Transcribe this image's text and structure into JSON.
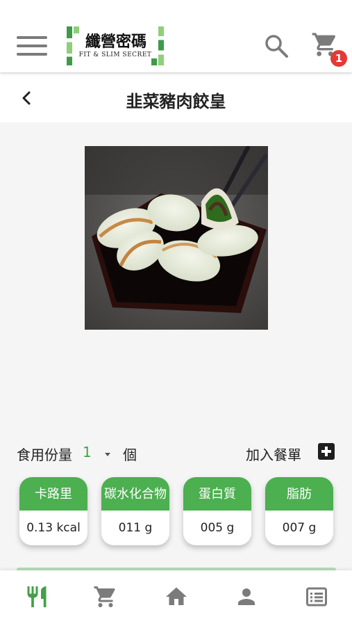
{
  "header": {
    "logo_title": "纖營密碼",
    "logo_subtitle": "FIT & SLIM SECRET",
    "cart_count": "1",
    "icons": [
      "menu-icon",
      "search-icon",
      "cart-icon"
    ]
  },
  "page": {
    "title": "韭菜豬肉餃皇",
    "back_icon": "chevron-left-icon"
  },
  "product": {
    "image_icon": "dumpling-photo"
  },
  "order": {
    "quantity_label": "食用份量",
    "quantity_value": "1",
    "unit": "個",
    "add_label": "加入餐單",
    "add_icon": "plus-square-icon"
  },
  "nutrition": [
    {
      "label": "卡路里",
      "value": "0.13 kcal"
    },
    {
      "label": "碳水化合物",
      "value": "011 g"
    },
    {
      "label": "蛋白質",
      "value": "005 g"
    },
    {
      "label": "脂肪",
      "value": "007 g"
    }
  ],
  "bottom_nav": {
    "items": [
      "fork-knife-icon",
      "cart-icon",
      "home-icon",
      "person-icon",
      "list-icon"
    ],
    "active": "fork-knife-icon"
  },
  "colors": {
    "accent": "#4caf50",
    "active_nav": "#43a047",
    "badge": "#e53935",
    "icon_grey": "#7b7b7b"
  }
}
